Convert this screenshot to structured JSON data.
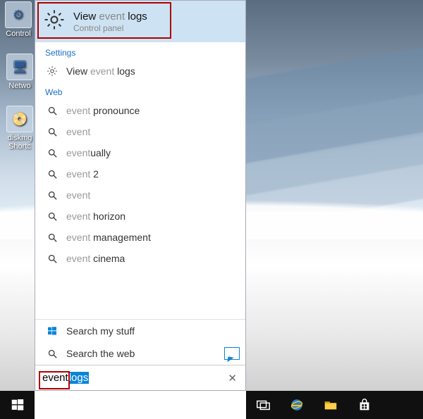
{
  "desktop": {
    "icons": [
      {
        "label": "Control"
      },
      {
        "label": "Netwo"
      },
      {
        "label": "diskmg Shortc"
      }
    ]
  },
  "search": {
    "best_match": {
      "prefix": "View ",
      "faded": "event",
      "suffix": " logs",
      "subtitle": "Control panel"
    },
    "sections": {
      "settings_label": "Settings",
      "web_label": "Web"
    },
    "settings_results": [
      {
        "prefix": "View ",
        "faded": "event",
        "suffix": " logs"
      }
    ],
    "web_results": [
      {
        "faded": "event",
        "suffix": "   pronounce"
      },
      {
        "faded": "event",
        "suffix": ""
      },
      {
        "faded": "event",
        "suffix": "ually"
      },
      {
        "faded": "event",
        "suffix": " 2"
      },
      {
        "faded": "event",
        "suffix": ""
      },
      {
        "faded": "event",
        "suffix": " horizon"
      },
      {
        "faded": "event",
        "suffix": " management"
      },
      {
        "faded": "event",
        "suffix": " cinema"
      }
    ],
    "bottom": {
      "my_stuff": "Search my stuff",
      "web": "Search the web"
    },
    "box": {
      "typed": "event",
      "selected": " logs"
    }
  },
  "taskbar": {
    "items": [
      "start",
      "task-view",
      "edge",
      "explorer",
      "store"
    ]
  }
}
